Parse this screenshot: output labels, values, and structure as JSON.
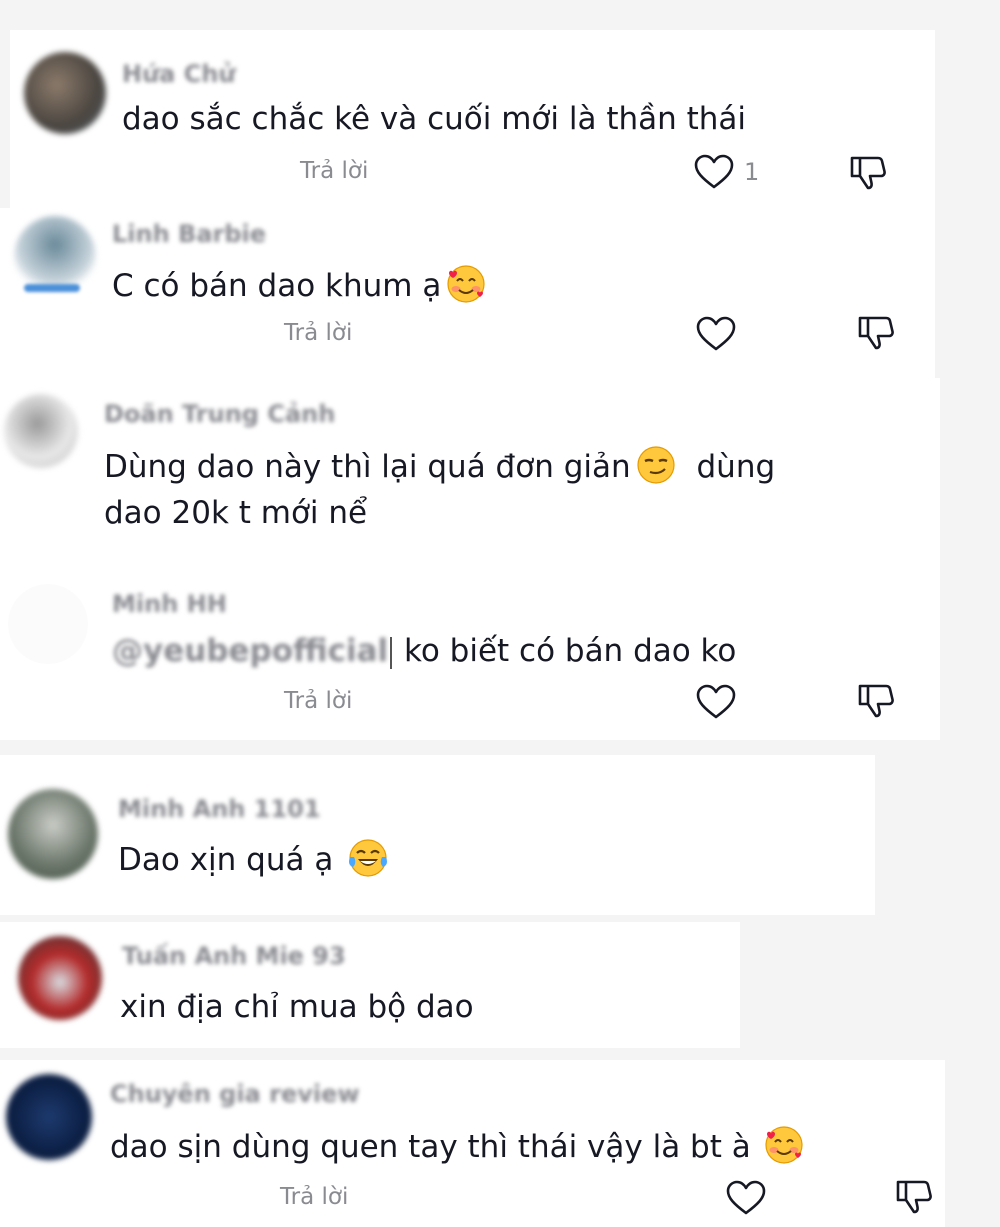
{
  "comments": [
    {
      "name": "Hứa Chử",
      "text": "dao sắc chắc kê và cuối mới là thần thái",
      "reply": "Trả lời",
      "likes": "1"
    },
    {
      "name": "Linh Barbie",
      "text": "C có bán dao khum ạ",
      "reply": "Trả lời",
      "likes": ""
    },
    {
      "name": "Doãn Trung Cảnh",
      "text_line1": "Dùng dao này thì lại quá đơn giản",
      "text_line1b": "dùng",
      "text_line2": "dao 20k t mới nể"
    },
    {
      "name": "Minh HH",
      "mention": "@yeubepofficial",
      "text": "ko biết có bán dao ko",
      "reply": "Trả lời",
      "likes": ""
    },
    {
      "name": "Minh Anh 1101",
      "text": "Dao xịn quá ạ"
    },
    {
      "name": "Tuấn Anh Mie 93",
      "text": "xin địa chỉ mua bộ dao"
    },
    {
      "name": "Chuyên gia review",
      "text": "dao sịn dùng quen tay thì thái vậy là bt à",
      "reply": "Trả lời",
      "likes": ""
    }
  ],
  "icons": {
    "like": "heart-outline-icon",
    "dislike": "thumbs-down-icon"
  },
  "colors": {
    "text": "#161823",
    "muted": "#8a8b91",
    "background": "#f4f4f4",
    "card": "#ffffff"
  }
}
